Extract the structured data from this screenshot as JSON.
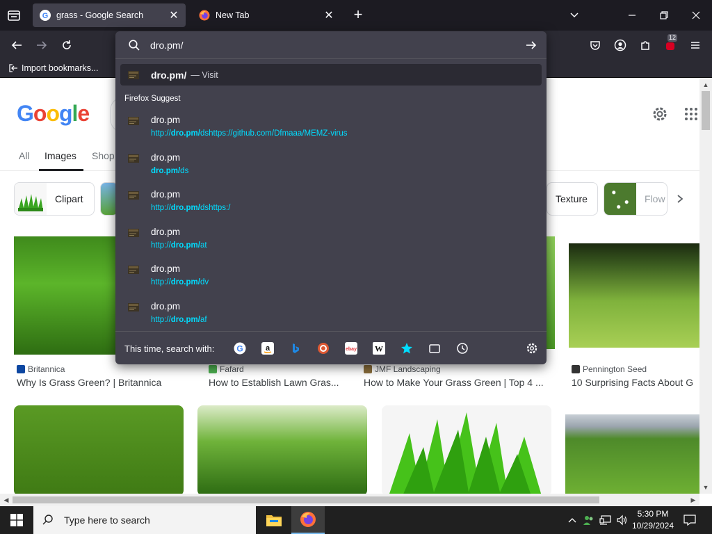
{
  "browser": {
    "tabs": [
      {
        "title": "grass - Google Search",
        "active": true
      },
      {
        "title": "New Tab",
        "active": false
      }
    ],
    "extensions_badge": "12",
    "bookmarks": [
      {
        "label": "Import bookmarks..."
      }
    ]
  },
  "urlbar": {
    "value": "dro.pm/",
    "heuristic": {
      "title": "dro.pm/",
      "action": "— Visit"
    },
    "group_label": "Firefox Suggest",
    "suggestions": [
      {
        "title": "dro.pm",
        "url_pre": "http://",
        "url_bold": "dro.pm/",
        "url_post": "dshttps://github.com/Dfmaaa/MEMZ-virus"
      },
      {
        "title": "dro.pm",
        "url_pre": "",
        "url_bold": "dro.pm/",
        "url_post": "ds"
      },
      {
        "title": "dro.pm",
        "url_pre": "http://",
        "url_bold": "dro.pm/",
        "url_post": "dshttps:/"
      },
      {
        "title": "dro.pm",
        "url_pre": "http://",
        "url_bold": "dro.pm/",
        "url_post": "at"
      },
      {
        "title": "dro.pm",
        "url_pre": "http://",
        "url_bold": "dro.pm/",
        "url_post": "dv"
      },
      {
        "title": "dro.pm",
        "url_pre": "http://",
        "url_bold": "dro.pm/",
        "url_post": "af"
      }
    ],
    "search_with_label": "This time, search with:",
    "engines": [
      "google-icon",
      "amazon-icon",
      "bing-icon",
      "duckduckgo-icon",
      "ebay-icon",
      "wikipedia-icon",
      "bookmarks-star-icon",
      "tabs-icon",
      "history-icon"
    ]
  },
  "google": {
    "logo": "Google",
    "tabs": [
      "All",
      "Images",
      "Shop"
    ],
    "active_tab": "Images",
    "chips": [
      {
        "label": "Clipart"
      },
      {
        "label": "Texture"
      },
      {
        "label": "Flow"
      }
    ],
    "results": [
      {
        "source": "Britannica",
        "caption": "Why Is Grass Green? | Britannica"
      },
      {
        "source": "Fafard",
        "caption": "How to Establish Lawn Gras..."
      },
      {
        "source": "JMF Landscaping",
        "caption": "How to Make Your Grass Green | Top 4 ..."
      },
      {
        "source": "Pennington Seed",
        "caption": "10 Surprising Facts About G"
      }
    ]
  },
  "taskbar": {
    "search_placeholder": "Type here to search",
    "time": "5:30 PM",
    "date": "10/29/2024"
  },
  "colors": {
    "accent": "#00ddff",
    "popup_bg": "#42414d",
    "chrome_bg": "#2b2a33"
  }
}
